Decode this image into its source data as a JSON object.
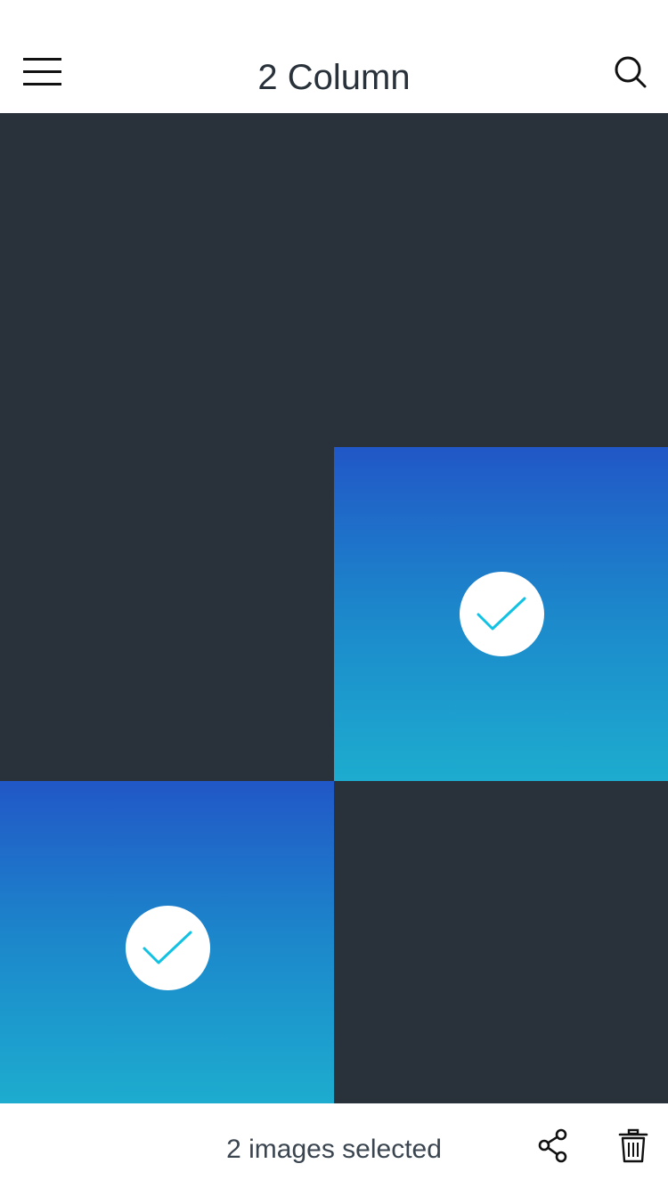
{
  "header": {
    "title": "2 Column",
    "menu_icon": "hamburger-menu-icon",
    "search_icon": "search-icon"
  },
  "grid": {
    "columns": 2,
    "tiles": [
      {
        "selected": false
      },
      {
        "selected": false
      },
      {
        "selected": false
      },
      {
        "selected": true,
        "icon": "checkmark-icon"
      },
      {
        "selected": true,
        "icon": "checkmark-icon"
      },
      {
        "selected": false
      }
    ]
  },
  "bottom_bar": {
    "selection_text": "2 images selected",
    "share_icon": "share-icon",
    "trash_icon": "trash-icon"
  },
  "colors": {
    "tile_dark": "#29323a",
    "selected_gradient_top": "#2157c7",
    "selected_gradient_bottom": "#1daccf",
    "check_stroke": "#12c2e3",
    "text": "#29323a"
  }
}
